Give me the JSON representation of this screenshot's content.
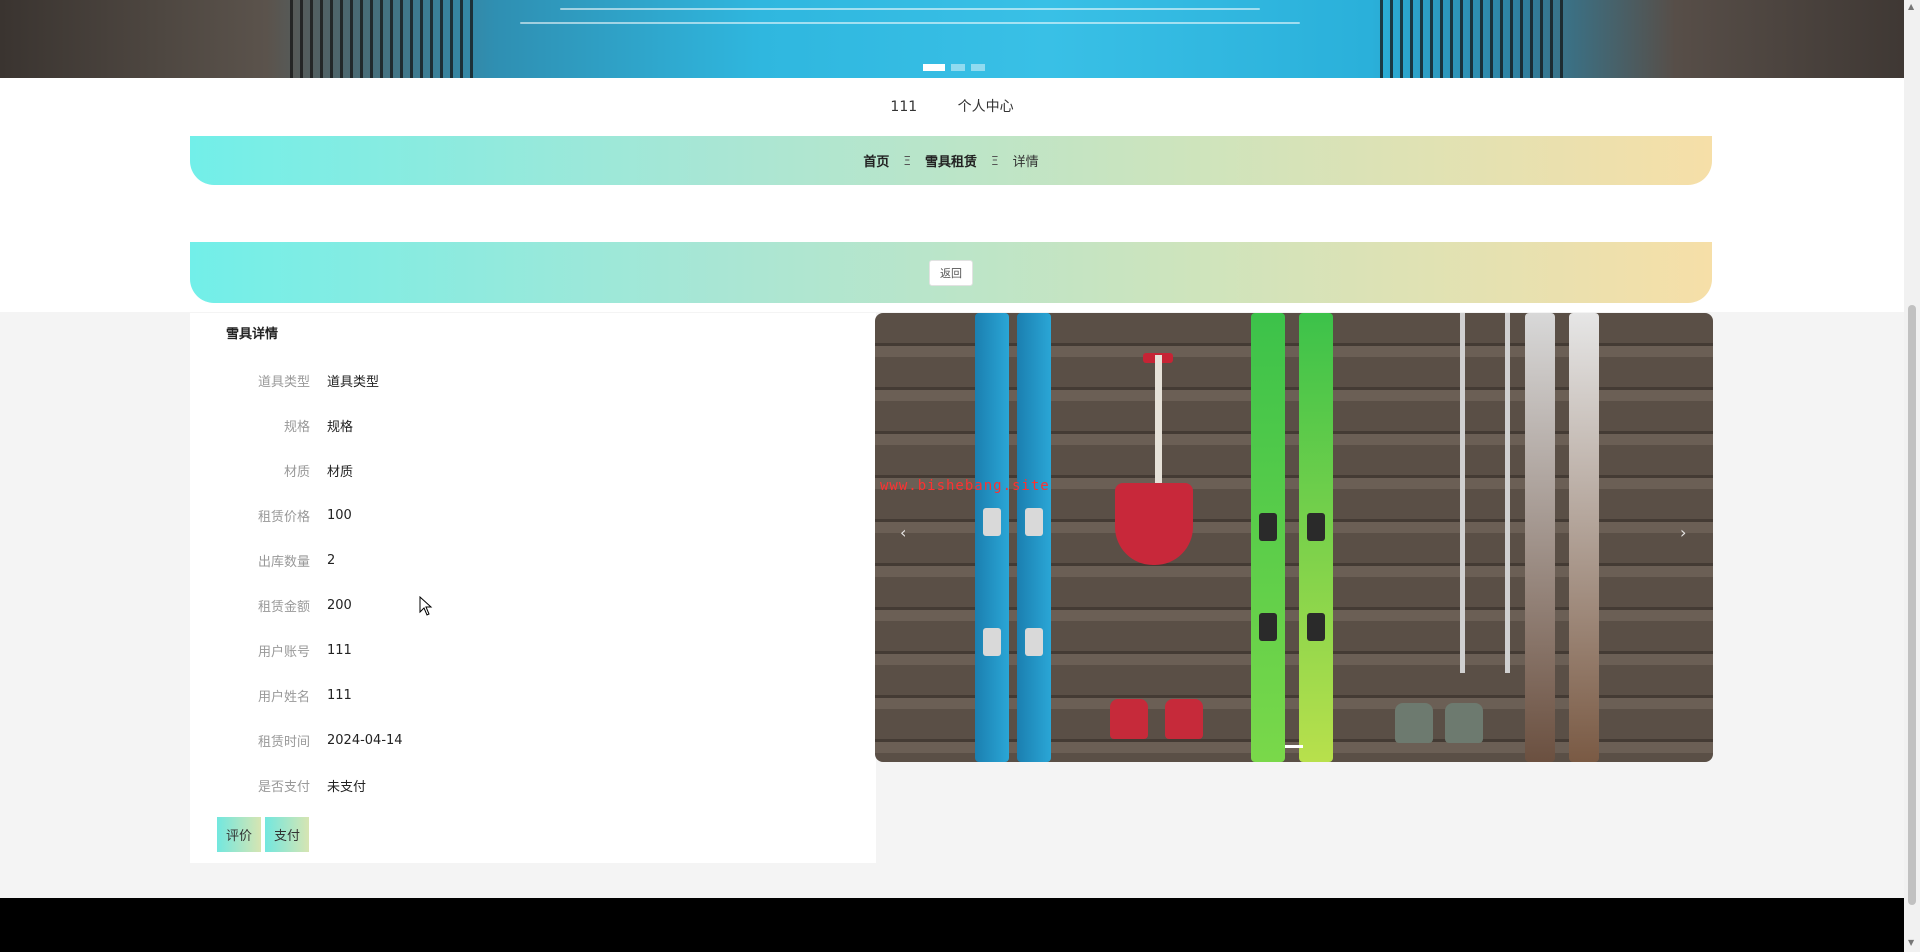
{
  "usermenu": {
    "username": "111",
    "personal_center": "个人中心"
  },
  "breadcrumb": {
    "home": "首页",
    "separator": "Ξ",
    "category": "雪具租赁",
    "current": "详情"
  },
  "back_label": "返回",
  "detail": {
    "title": "雪具详情",
    "fields": [
      {
        "label": "道具类型",
        "value": "道具类型"
      },
      {
        "label": "规格",
        "value": "规格"
      },
      {
        "label": "材质",
        "value": "材质"
      },
      {
        "label": "租赁价格",
        "value": "100"
      },
      {
        "label": "出库数量",
        "value": "2"
      },
      {
        "label": "租赁金额",
        "value": "200"
      },
      {
        "label": "用户账号",
        "value": "111"
      },
      {
        "label": "用户姓名",
        "value": "111"
      },
      {
        "label": "租赁时间",
        "value": "2024-04-14"
      },
      {
        "label": "是否支付",
        "value": "未支付"
      }
    ],
    "actions": {
      "review": "评价",
      "pay": "支付"
    }
  },
  "image": {
    "watermark": "www.bishebang.site",
    "prev_arrow": "‹",
    "next_arrow": "›"
  },
  "colors": {
    "gradient_start": "#72efe9",
    "gradient_end": "#f6dfa8",
    "footer": "#000000"
  },
  "banner_dots": 3
}
